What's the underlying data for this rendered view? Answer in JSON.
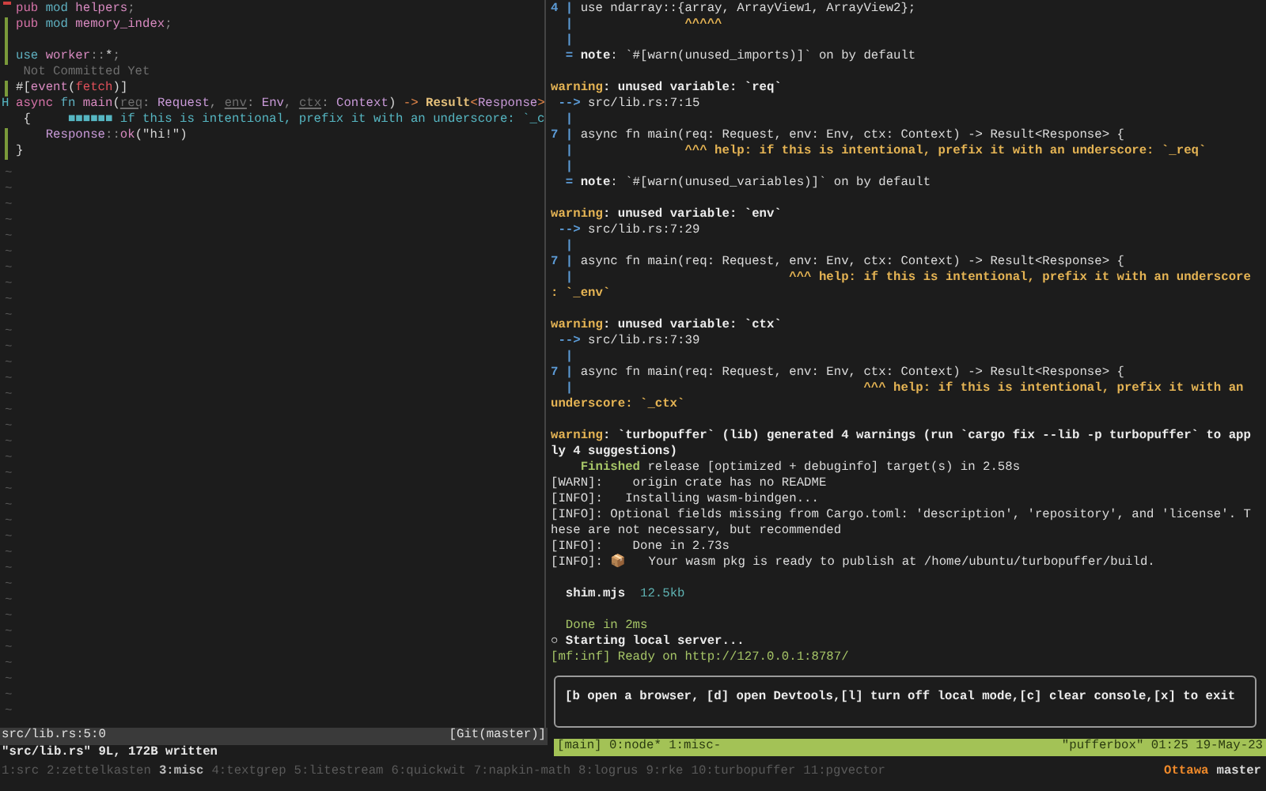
{
  "editor": {
    "lines": [
      {
        "kind": "removed",
        "segments": [
          {
            "text": "pub ",
            "kind": "kw"
          },
          {
            "text": "mod ",
            "kind": "kw2"
          },
          {
            "text": "helpers",
            "kind": "name"
          },
          {
            "text": ";",
            "kind": "punct"
          }
        ]
      },
      {
        "kind": "added",
        "segments": [
          {
            "text": "pub ",
            "kind": "kw"
          },
          {
            "text": "mod ",
            "kind": "kw2"
          },
          {
            "text": "memory_index",
            "kind": "name"
          },
          {
            "text": ";",
            "kind": "punct"
          }
        ]
      },
      {
        "kind": "added"
      },
      {
        "kind": "added",
        "segments": [
          {
            "text": "use ",
            "kind": "kw2"
          },
          {
            "text": "worker",
            "kind": "name"
          },
          {
            "text": "::",
            "kind": "punct"
          },
          {
            "text": "*",
            "kind": "plain"
          },
          {
            "text": ";",
            "kind": "punct"
          }
        ]
      },
      {
        "kind": "plain",
        "segments": [
          {
            "text": " Not Committed Yet",
            "kind": "virtual"
          }
        ]
      },
      {
        "kind": "added",
        "segments": [
          {
            "text": "#[",
            "kind": "plain"
          },
          {
            "text": "event",
            "kind": "name"
          },
          {
            "text": "(",
            "kind": "plain"
          },
          {
            "text": "fetch",
            "kind": "red"
          },
          {
            "text": ")]",
            "kind": "plain"
          }
        ]
      },
      {
        "kind": "hint",
        "sign": "H",
        "segments": [
          {
            "text": "async ",
            "kind": "kw"
          },
          {
            "text": "fn ",
            "kind": "kw2"
          },
          {
            "text": "main",
            "kind": "name"
          },
          {
            "text": "(",
            "kind": "plain"
          },
          {
            "text": "req",
            "kind": "unused"
          },
          {
            "text": ": ",
            "kind": "punct"
          },
          {
            "text": "Request",
            "kind": "type"
          },
          {
            "text": ", ",
            "kind": "punct"
          },
          {
            "text": "env",
            "kind": "unused"
          },
          {
            "text": ": ",
            "kind": "punct"
          },
          {
            "text": "Env",
            "kind": "type"
          },
          {
            "text": ", ",
            "kind": "punct"
          },
          {
            "text": "ctx",
            "kind": "unused"
          },
          {
            "text": ": ",
            "kind": "punct"
          },
          {
            "text": "Context",
            "kind": "type"
          },
          {
            "text": ") ",
            "kind": "plain"
          },
          {
            "text": "-> ",
            "kind": "arrow"
          },
          {
            "text": "Result",
            "kind": "result"
          },
          {
            "text": "<",
            "kind": "arrow"
          },
          {
            "text": "Response",
            "kind": "type"
          },
          {
            "text": ">",
            "kind": "arrow"
          }
        ]
      },
      {
        "kind": "plain",
        "segments": [
          {
            "text": " {     ",
            "kind": "plain"
          },
          {
            "text": "■■■■■■ if this is intentional, prefix it with an underscore: `_c",
            "kind": "diag"
          }
        ]
      },
      {
        "kind": "added",
        "segments": [
          {
            "text": "    Response",
            "kind": "type"
          },
          {
            "text": "::",
            "kind": "punct"
          },
          {
            "text": "ok",
            "kind": "name"
          },
          {
            "text": "(\"hi!\")",
            "kind": "plain"
          }
        ]
      },
      {
        "kind": "added",
        "segments": [
          {
            "text": "}",
            "kind": "plain"
          }
        ]
      }
    ],
    "filler": [
      "~",
      "~",
      "~",
      "~",
      "~",
      "~",
      "~",
      "~",
      "~",
      "~",
      "~",
      "~",
      "~",
      "~",
      "~",
      "~",
      "~",
      "~",
      "~",
      "~",
      "~",
      "~",
      "~",
      "~",
      "~",
      "~",
      "~",
      "~",
      "~",
      "~",
      "~",
      "~",
      "~",
      "~",
      "~"
    ],
    "status": {
      "file": "src/lib.rs:5:0",
      "branch": "[Git(master)]"
    },
    "message": "\"src/lib.rs\" 9L, 172B written"
  },
  "terminal": {
    "blocks": [
      {
        "lines": [
          [
            {
              "text": "4 | ",
              "kind": "lineno"
            },
            {
              "text": "use ndarray::{array, ArrayView1, ArrayView2};",
              "kind": "text"
            }
          ],
          [
            {
              "text": "  | ",
              "kind": "lineno"
            },
            {
              "text": "              ^^^^^",
              "kind": "caret"
            }
          ],
          [
            {
              "text": "  |",
              "kind": "lineno"
            }
          ],
          [
            {
              "text": "  = ",
              "kind": "lineno"
            },
            {
              "text": "note",
              "kind": "bold"
            },
            {
              "text": ": `#[warn(unused_imports)]` on by default",
              "kind": "text"
            }
          ]
        ]
      },
      {
        "lines": [
          [
            {
              "text": "warning",
              "kind": "warning"
            },
            {
              "text": ": unused variable: `req`",
              "kind": "bold"
            }
          ],
          [
            {
              "text": " --> ",
              "kind": "lineno"
            },
            {
              "text": "src/lib.rs:7:15",
              "kind": "text"
            }
          ],
          [
            {
              "text": "  |",
              "kind": "lineno"
            }
          ],
          [
            {
              "text": "7 | ",
              "kind": "lineno"
            },
            {
              "text": "async fn main(req: Request, env: Env, ctx: Context) -> Result<Response> {",
              "kind": "text"
            }
          ],
          [
            {
              "text": "  | ",
              "kind": "lineno"
            },
            {
              "text": "              ^^^ help: if this is intentional, prefix it with an underscore: `_req`",
              "kind": "help"
            }
          ],
          [
            {
              "text": "  |",
              "kind": "lineno"
            }
          ],
          [
            {
              "text": "  = ",
              "kind": "lineno"
            },
            {
              "text": "note",
              "kind": "bold"
            },
            {
              "text": ": `#[warn(unused_variables)]` on by default",
              "kind": "text"
            }
          ]
        ]
      },
      {
        "lines": [
          [
            {
              "text": "warning",
              "kind": "warning"
            },
            {
              "text": ": unused variable: `env`",
              "kind": "bold"
            }
          ],
          [
            {
              "text": " --> ",
              "kind": "lineno"
            },
            {
              "text": "src/lib.rs:7:29",
              "kind": "text"
            }
          ],
          [
            {
              "text": "  |",
              "kind": "lineno"
            }
          ],
          [
            {
              "text": "7 | ",
              "kind": "lineno"
            },
            {
              "text": "async fn main(req: Request, env: Env, ctx: Context) -> Result<Response> {",
              "kind": "text"
            }
          ],
          [
            {
              "text": "  | ",
              "kind": "lineno"
            },
            {
              "text": "                            ^^^ help: if this is intentional, prefix it with an underscore",
              "kind": "help"
            }
          ],
          [
            {
              "text": ": `_env`",
              "kind": "help"
            }
          ]
        ]
      },
      {
        "lines": [
          [
            {
              "text": "warning",
              "kind": "warning"
            },
            {
              "text": ": unused variable: `ctx`",
              "kind": "bold"
            }
          ],
          [
            {
              "text": " --> ",
              "kind": "lineno"
            },
            {
              "text": "src/lib.rs:7:39",
              "kind": "text"
            }
          ],
          [
            {
              "text": "  |",
              "kind": "lineno"
            }
          ],
          [
            {
              "text": "7 | ",
              "kind": "lineno"
            },
            {
              "text": "async fn main(req: Request, env: Env, ctx: Context) -> Result<Response> {",
              "kind": "text"
            }
          ],
          [
            {
              "text": "  | ",
              "kind": "lineno"
            },
            {
              "text": "                                      ^^^ help: if this is intentional, prefix it with an",
              "kind": "help"
            }
          ],
          [
            {
              "text": "underscore: `_ctx`",
              "kind": "help"
            }
          ]
        ]
      },
      {
        "lines": [
          [
            {
              "text": "warning",
              "kind": "warning"
            },
            {
              "text": ": `turbopuffer` (lib) generated 4 warnings (run `cargo fix --lib -p turbopuffer` to app",
              "kind": "bold"
            }
          ],
          [
            {
              "text": "ly 4 suggestions)",
              "kind": "bold"
            }
          ],
          [
            {
              "text": "    Finished",
              "kind": "finished"
            },
            {
              "text": " release [optimized + debuginfo] target(s) in 2.58s",
              "kind": "text"
            }
          ],
          [
            {
              "text": "[WARN]:    origin crate has no README",
              "kind": "text"
            }
          ],
          [
            {
              "text": "[INFO]:   Installing wasm-bindgen...",
              "kind": "text"
            }
          ],
          [
            {
              "text": "[INFO]: Optional fields missing from Cargo.toml: 'description', 'repository', and 'license'. T",
              "kind": "text"
            }
          ],
          [
            {
              "text": "hese are not necessary, but recommended",
              "kind": "text"
            }
          ],
          [
            {
              "text": "[INFO]:    Done in 2.73s",
              "kind": "text"
            }
          ],
          [
            {
              "text": "[INFO]: 📦   Your wasm pkg is ready to publish at /home/ubuntu/turbopuffer/build.",
              "kind": "text"
            }
          ]
        ]
      },
      {
        "lines": [
          [
            {
              "text": "  shim.mjs",
              "kind": "bold"
            },
            {
              "text": "  12.5kb",
              "kind": "size"
            }
          ]
        ]
      },
      {
        "lines": [
          [
            {
              "text": "  Done in 2ms",
              "kind": "green"
            }
          ],
          [
            {
              "text": "○ Starting local server...",
              "kind": "bold"
            }
          ],
          [
            {
              "text": "[mf:inf] Ready on http://127.0.0.1:8787/",
              "kind": "green"
            }
          ]
        ]
      }
    ],
    "keybindings": "[b open a browser, [d] open Devtools,[l] turn off local mode,[c] clear console,[x] to exit"
  },
  "tmux": {
    "session": "[main] 0:node* 1:misc-",
    "host": "\"pufferbox\" 01:25 19-May-23"
  },
  "windows": [
    {
      "label": "1:src",
      "selected": false
    },
    {
      "label": "2:zettelkasten",
      "selected": false
    },
    {
      "label": "3:misc",
      "selected": true
    },
    {
      "label": "4:textgrep",
      "selected": false
    },
    {
      "label": "5:litestream",
      "selected": false
    },
    {
      "label": "6:quickwit",
      "selected": false
    },
    {
      "label": "7:napkin-math",
      "selected": false
    },
    {
      "label": "8:logrus",
      "selected": false
    },
    {
      "label": "9:rke",
      "selected": false
    },
    {
      "label": "10:turbopuffer",
      "selected": false
    },
    {
      "label": "11:pgvector",
      "selected": false
    }
  ],
  "location": {
    "city": "Ottawa",
    "branch": "master"
  }
}
